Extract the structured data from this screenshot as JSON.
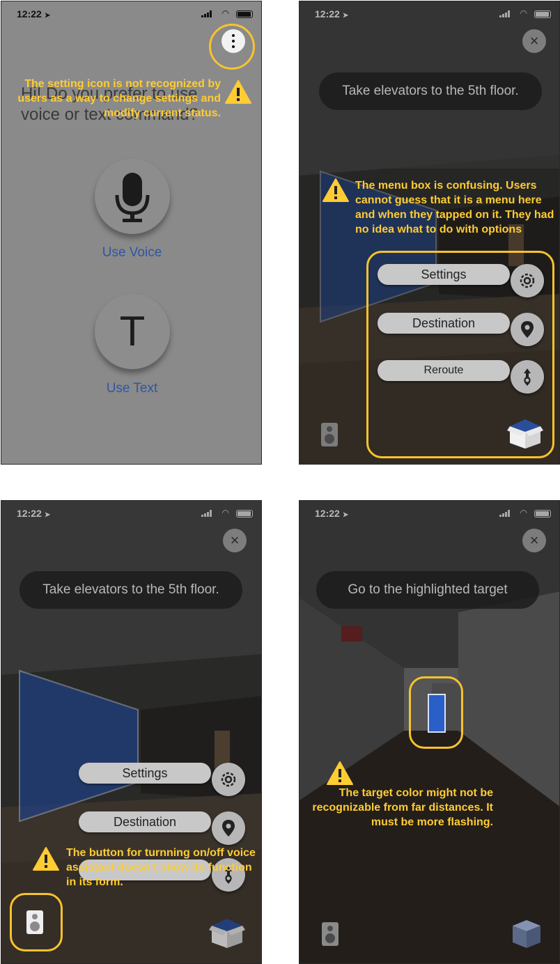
{
  "status_time": "12:22",
  "colors": {
    "annotation": "#ffcc33",
    "highlight_ring": "#f7c32e",
    "link_blue": "#2e56a3",
    "glass_blue": "#2a5fc8"
  },
  "panel1": {
    "prompt": "Hi! Do you prefer to use voice or text command?",
    "voice_label": "Use Voice",
    "text_glyph": "T",
    "text_label": "Use Text",
    "annotation": "The setting icon is not recognized by users as a way to change settings and modify current status.",
    "icons": [
      "microphone-icon",
      "kebab-menu-icon",
      "warning-icon"
    ]
  },
  "panel2": {
    "banner": "Take elevators to the 5th floor.",
    "menu": [
      "Settings",
      "Destination",
      "Reroute"
    ],
    "annotation": "The menu box is confusing. Users cannot guess that it is a menu here and when they tapped on it. They had no idea what to do with options",
    "icons": [
      "close-icon",
      "gear-icon",
      "location-pin-icon",
      "reroute-icon",
      "speaker-icon",
      "box-icon",
      "warning-icon"
    ]
  },
  "panel3": {
    "banner": "Take elevators to the 5th floor.",
    "menu": [
      "Settings",
      "Destination"
    ],
    "annotation": "The button for turnning on/off voice assistant doesn’t show its function in its form.",
    "icons": [
      "close-icon",
      "gear-icon",
      "location-pin-icon",
      "reroute-icon",
      "speaker-icon",
      "box-icon",
      "warning-icon"
    ]
  },
  "panel4": {
    "banner": "Go to the highlighted target",
    "annotation": "The target color might not be recognizable from far distances. It must be more flashing.",
    "icons": [
      "close-icon",
      "speaker-icon",
      "cube-icon",
      "warning-icon",
      "target-marker"
    ]
  }
}
